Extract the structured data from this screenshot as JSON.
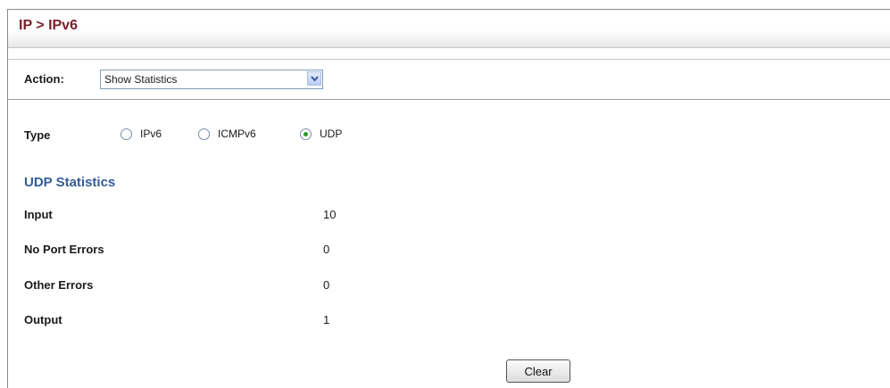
{
  "page": {
    "title": "IP > IPv6"
  },
  "action": {
    "label": "Action:",
    "selected": "Show Statistics"
  },
  "type": {
    "label": "Type",
    "options": [
      {
        "label": "IPv6",
        "checked": false
      },
      {
        "label": "ICMPv6",
        "checked": false
      },
      {
        "label": "UDP",
        "checked": true
      }
    ]
  },
  "stats": {
    "title": "UDP Statistics",
    "rows": [
      {
        "label": "Input",
        "value": "10"
      },
      {
        "label": "No Port Errors",
        "value": "0"
      },
      {
        "label": "Other Errors",
        "value": "0"
      },
      {
        "label": "Output",
        "value": "1"
      }
    ]
  },
  "buttons": {
    "clear": "Clear"
  },
  "icons": {
    "dropdown": "chevron-down-icon"
  },
  "colors": {
    "title": "#7a1f2b",
    "section": "#335d9a",
    "radio_dot": "#2d9a2d"
  }
}
